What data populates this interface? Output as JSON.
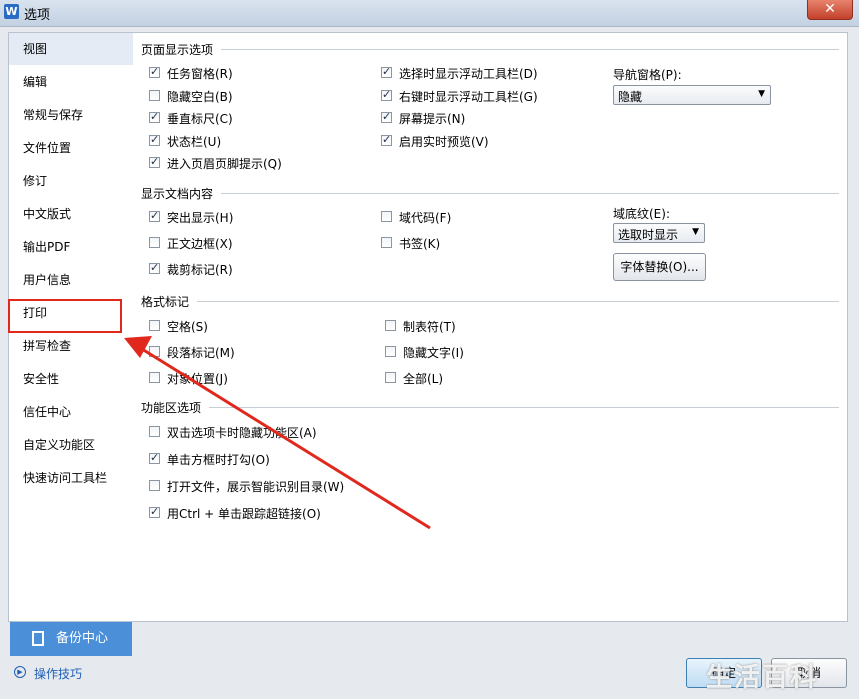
{
  "window": {
    "title": "选项",
    "close": "✕"
  },
  "sidebar": {
    "items": [
      {
        "label": "视图"
      },
      {
        "label": "编辑"
      },
      {
        "label": "常规与保存"
      },
      {
        "label": "文件位置"
      },
      {
        "label": "修订"
      },
      {
        "label": "中文版式"
      },
      {
        "label": "输出PDF"
      },
      {
        "label": "用户信息"
      },
      {
        "label": "打印"
      },
      {
        "label": "拼写检查"
      },
      {
        "label": "安全性"
      },
      {
        "label": "信任中心"
      },
      {
        "label": "自定义功能区"
      },
      {
        "label": "快速访问工具栏"
      }
    ],
    "selected": "视图",
    "backup_label": "备份中心",
    "tips_label": "操作技巧"
  },
  "page_display": {
    "heading": "页面显示选项",
    "col1": [
      {
        "label": "任务窗格(R)",
        "checked": true
      },
      {
        "label": "隐藏空白(B)",
        "checked": false
      },
      {
        "label": "垂直标尺(C)",
        "checked": true
      },
      {
        "label": "状态栏(U)",
        "checked": true
      },
      {
        "label": "进入页眉页脚提示(Q)",
        "checked": true
      }
    ],
    "col2": [
      {
        "label": "选择时显示浮动工具栏(D)",
        "checked": true
      },
      {
        "label": "右键时显示浮动工具栏(G)",
        "checked": true
      },
      {
        "label": "屏幕提示(N)",
        "checked": true
      },
      {
        "label": "启用实时预览(V)",
        "checked": true
      }
    ],
    "nav_label": "导航窗格(P):",
    "nav_value": "隐藏"
  },
  "doc_content": {
    "heading": "显示文档内容",
    "col1": [
      {
        "label": "突出显示(H)",
        "checked": true
      },
      {
        "label": "正文边框(X)",
        "checked": false
      },
      {
        "label": "裁剪标记(R)",
        "checked": true
      }
    ],
    "col2": [
      {
        "label": "域代码(F)",
        "checked": false
      },
      {
        "label": "书签(K)",
        "checked": false
      }
    ],
    "shading_label": "域底纹(E):",
    "shading_value": "选取时显示",
    "font_replace_button": "字体替换(O)..."
  },
  "format_marks": {
    "heading": "格式标记",
    "col1": [
      {
        "label": "空格(S)",
        "checked": false
      },
      {
        "label": "段落标记(M)",
        "checked": false
      },
      {
        "label": "对象位置(J)",
        "checked": false
      }
    ],
    "col2": [
      {
        "label": "制表符(T)",
        "checked": false
      },
      {
        "label": "隐藏文字(I)",
        "checked": false
      },
      {
        "label": "全部(L)",
        "checked": false
      }
    ]
  },
  "ribbon": {
    "heading": "功能区选项",
    "items": [
      {
        "label": "双击选项卡时隐藏功能区(A)",
        "checked": false
      },
      {
        "label": "单击方框时打勾(O)",
        "checked": true
      },
      {
        "label": "打开文件，展示智能识别目录(W)",
        "checked": false
      },
      {
        "label": "用Ctrl + 单击跟踪超链接(O)",
        "checked": true
      }
    ]
  },
  "footer": {
    "ok": "确定",
    "cancel": "取消"
  },
  "watermark": "生活百科",
  "colors": {
    "annotation": "#e0281c",
    "backup_bg": "#4a8fd8",
    "accent": "#1f5fb5"
  }
}
